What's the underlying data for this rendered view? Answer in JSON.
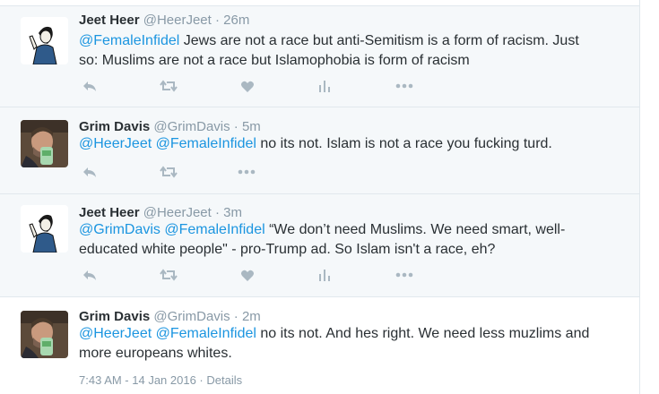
{
  "tweets": [
    {
      "fullname": "Jeet Heer",
      "handle": "@HeerJeet",
      "time": "26m",
      "mentions": [
        "@FemaleInfidel"
      ],
      "text_line1": " Jews are not a race but anti-Semitism is a form of racism. Just",
      "text_line2": "so: Muslims are not a race but Islamophobia is form of racism",
      "avatar": "cartoon-figure-avatar",
      "actions": [
        "reply-icon",
        "retweet-icon",
        "like-icon",
        "analytics-icon",
        "more-icon"
      ]
    },
    {
      "fullname": "Grim Davis",
      "handle": "@GrimDavis",
      "time": "5m",
      "mentions": [
        "@HeerJeet",
        "@FemaleInfidel"
      ],
      "text_line1": " no its not. Islam is not a race you fucking turd.",
      "avatar": "photo-man-avatar",
      "actions": [
        "reply-icon",
        "retweet-icon",
        "more-icon"
      ]
    },
    {
      "fullname": "Jeet Heer",
      "handle": "@HeerJeet",
      "time": "3m",
      "mentions": [
        "@GrimDavis",
        "@FemaleInfidel"
      ],
      "text_line1": " “We don’t need Muslims. We need smart, well-",
      "text_line2": "educated white people\" - pro-Trump ad. So Islam isn't a race, eh?",
      "avatar": "cartoon-figure-avatar",
      "actions": [
        "reply-icon",
        "retweet-icon",
        "like-icon",
        "analytics-icon",
        "more-icon"
      ]
    },
    {
      "fullname": "Grim Davis",
      "handle": "@GrimDavis",
      "time": "2m",
      "mentions": [
        "@HeerJeet",
        "@FemaleInfidel"
      ],
      "text_line1": " no its not. And hes right. We need less muzlims and",
      "text_line2": "more europeans whites.",
      "meta": "7:43 AM - 14 Jan 2016 · Details",
      "avatar": "photo-man-avatar"
    }
  ],
  "separator": " · ",
  "colors": {
    "link": "#1b95e0",
    "muted": "#8899a6",
    "icon": "#aab8c2",
    "reply_bg": "#f5f8fa",
    "border": "#e1e8ed"
  }
}
